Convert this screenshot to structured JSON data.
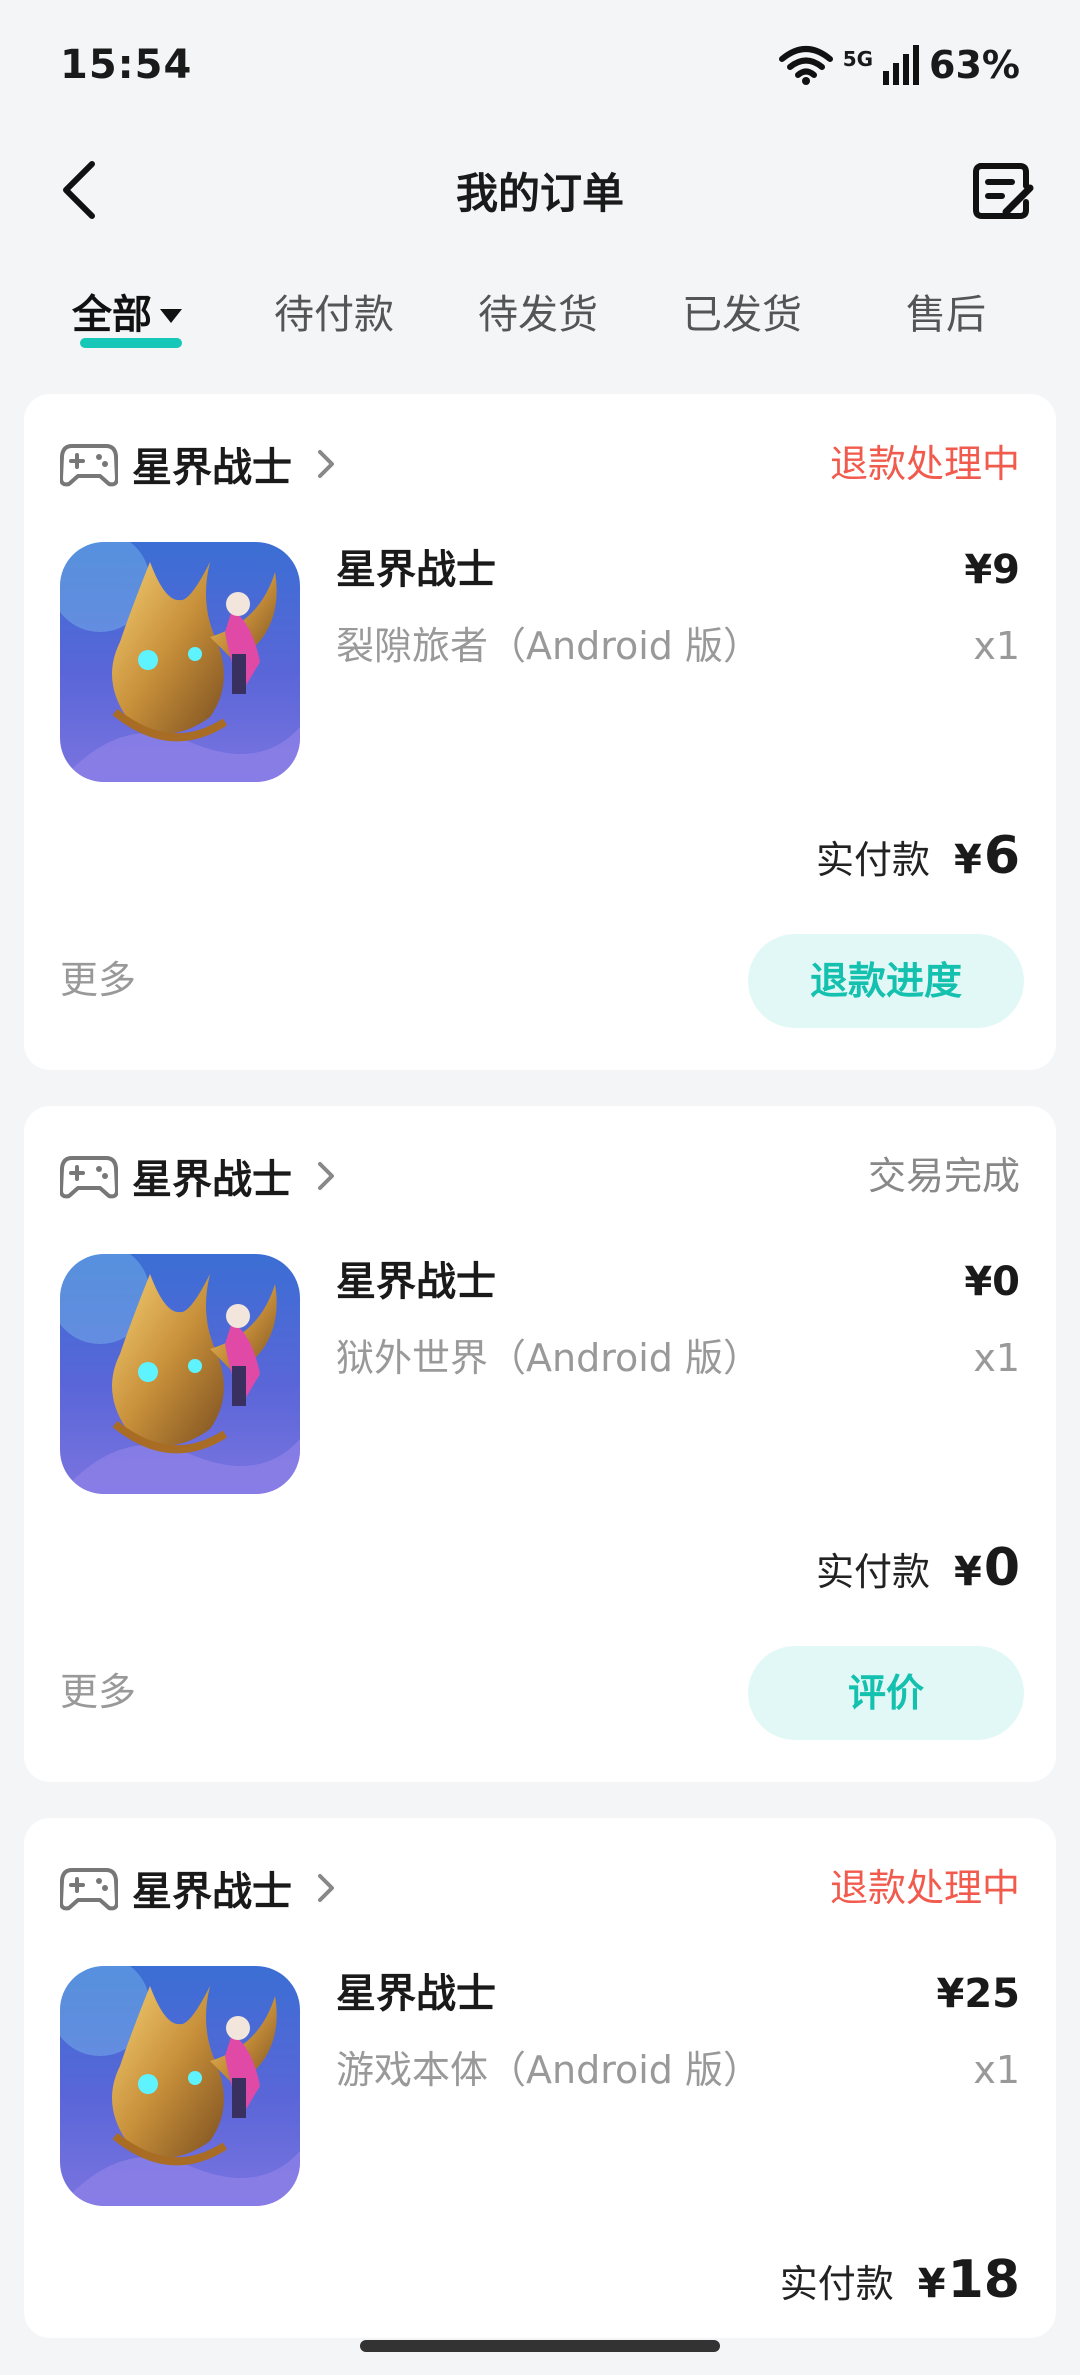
{
  "status_bar": {
    "time": "15:54",
    "network": "5G",
    "battery": "63%",
    "icons": [
      "wifi-icon",
      "signal-icon"
    ]
  },
  "header": {
    "title": "我的订单",
    "back_icon": "chevron-left-icon",
    "action_icon": "edit-list-icon"
  },
  "tabs": [
    {
      "label": "全部",
      "active": true
    },
    {
      "label": "待付款",
      "active": false
    },
    {
      "label": "待发货",
      "active": false
    },
    {
      "label": "已发货",
      "active": false
    },
    {
      "label": "售后",
      "active": false
    }
  ],
  "colors": {
    "accent": "#17c7b7",
    "status_red": "#f15b4e",
    "button_bg": "#e2f8f6"
  },
  "orders": [
    {
      "shop": "星界战士",
      "status": "退款处理中",
      "status_color": "red",
      "product_name": "星界战士",
      "variant": "裂隙旅者（Android 版）",
      "price": "¥9",
      "qty": "x1",
      "paid_label": "实付款",
      "paid_currency": "¥",
      "paid_amount": "6",
      "more": "更多",
      "action": "退款进度"
    },
    {
      "shop": "星界战士",
      "status": "交易完成",
      "status_color": "gray",
      "product_name": "星界战士",
      "variant": "狱外世界（Android 版）",
      "price": "¥0",
      "qty": "x1",
      "paid_label": "实付款",
      "paid_currency": "¥",
      "paid_amount": "0",
      "more": "更多",
      "action": "评价"
    },
    {
      "shop": "星界战士",
      "status": "退款处理中",
      "status_color": "red",
      "product_name": "星界战士",
      "variant": "游戏本体（Android 版）",
      "price": "¥25",
      "qty": "x1",
      "paid_label": "实付款",
      "paid_currency": "¥",
      "paid_amount": "18"
    }
  ]
}
